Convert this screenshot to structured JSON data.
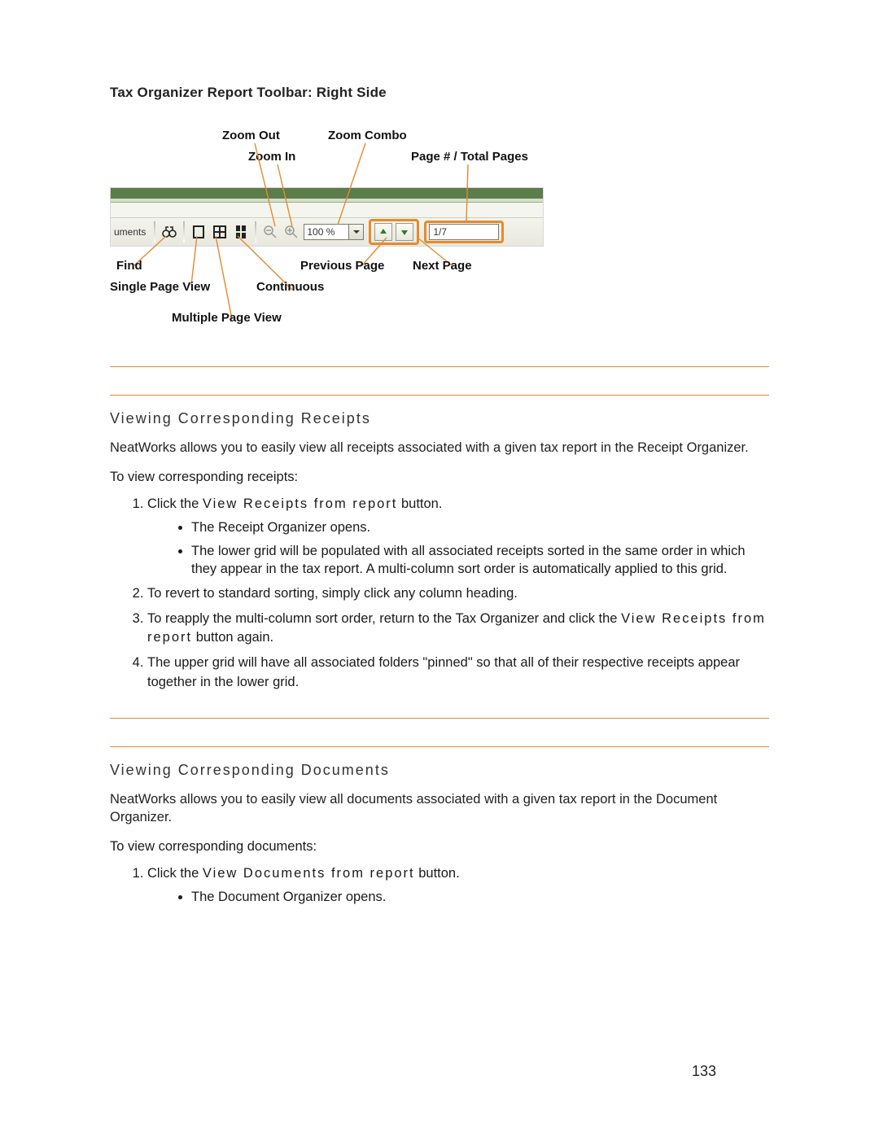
{
  "figure": {
    "title": "Tax Organizer Report Toolbar: Right Side",
    "labels": {
      "zoom_out": "Zoom Out",
      "zoom_combo": "Zoom Combo",
      "zoom_in": "Zoom In",
      "page_total": "Page # / Total Pages",
      "find": "Find",
      "previous_page": "Previous Page",
      "next_page": "Next Page",
      "single_page_view": "Single Page View",
      "continuous": "Continuous",
      "multiple_page_view": "Multiple Page View"
    },
    "toolbar": {
      "left_text": "uments",
      "zoom_value": "100 %",
      "page_value": "1/7"
    }
  },
  "section1": {
    "title": "Viewing Corresponding Receipts",
    "intro": "NeatWorks allows you to easily view all receipts associated with a given tax report in the Receipt Organizer.",
    "lead": "To view corresponding receipts:",
    "steps": [
      {
        "pre": "Click the ",
        "emph": "View Receipts from report",
        "post": " button.",
        "bullets": [
          "The Receipt Organizer opens.",
          "The lower grid will be populated with all associated receipts sorted in the same order in which they appear in the tax report. A multi-column sort order is automatically applied to this grid."
        ]
      },
      {
        "text": "To revert to standard sorting, simply click any column heading."
      },
      {
        "pre": "To reapply the multi-column sort order, return to the Tax Organizer and click the ",
        "emph": "View Receipts from report",
        "post": " button again."
      },
      {
        "text": "The upper grid will have all associated folders \"pinned\" so that all of their respective receipts appear together in the lower grid."
      }
    ]
  },
  "section2": {
    "title": "Viewing Corresponding Documents",
    "intro": "NeatWorks allows you to easily view all documents associated with a given tax report in the Document Organizer.",
    "lead": "To view corresponding documents:",
    "step1_pre": "Click the ",
    "step1_emph": "View Documents from report",
    "step1_post": " button.",
    "step1_bullet": "The Document Organizer opens."
  },
  "page_number": "133"
}
